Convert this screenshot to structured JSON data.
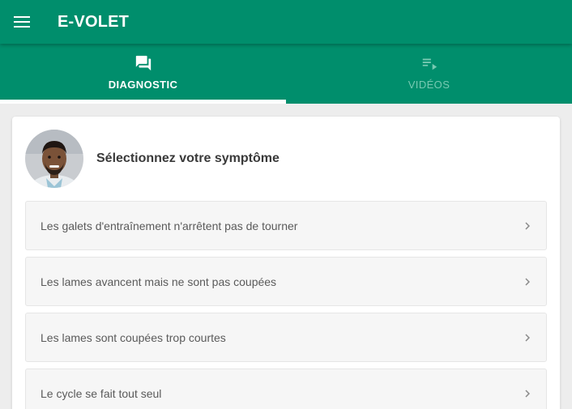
{
  "app": {
    "title": "E-VOLET",
    "menu_icon": "menu-icon",
    "colors": {
      "primary": "#008e6c",
      "tab_inactive": "#78c9b2",
      "background": "#ededed"
    }
  },
  "tabs": [
    {
      "label": "DIAGNOSTIC",
      "icon": "forum-icon",
      "active": true
    },
    {
      "label": "VIDÉOS",
      "icon": "playlist-icon",
      "active": false
    }
  ],
  "main": {
    "title": "Sélectionnez votre symptôme",
    "avatar": "technician-avatar",
    "symptoms": [
      {
        "label": "Les galets d'entraînement n'arrêtent pas de tourner",
        "icon": "chevron-right-icon"
      },
      {
        "label": "Les lames avancent mais ne sont pas coupées",
        "icon": "chevron-right-icon"
      },
      {
        "label": "Les lames sont coupées trop courtes",
        "icon": "chevron-right-icon"
      },
      {
        "label": "Le cycle se fait tout seul",
        "icon": "chevron-right-icon"
      }
    ]
  }
}
